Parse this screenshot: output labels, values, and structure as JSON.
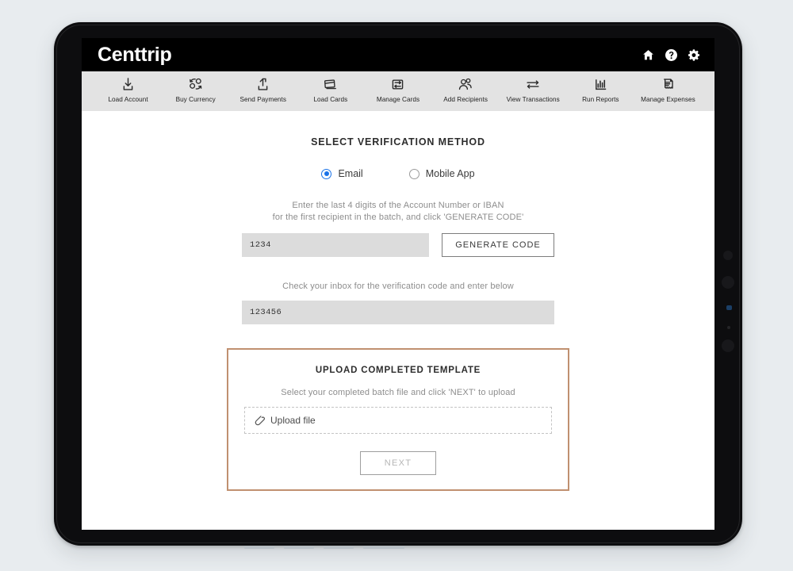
{
  "app": {
    "brand": "Centtrip",
    "header_icons": [
      {
        "name": "home-icon",
        "label": "Home"
      },
      {
        "name": "help-icon",
        "label": "Help"
      },
      {
        "name": "settings-gear-icon",
        "label": "Settings"
      }
    ]
  },
  "toolbar": {
    "items": [
      {
        "label": "Load Account",
        "icon": "download-tray-icon"
      },
      {
        "label": "Buy Currency",
        "icon": "currency-exchange-icon"
      },
      {
        "label": "Send Payments",
        "icon": "upload-tray-icon"
      },
      {
        "label": "Load Cards",
        "icon": "cards-stack-icon"
      },
      {
        "label": "Manage Cards",
        "icon": "card-refresh-icon"
      },
      {
        "label": "Add Recipients",
        "icon": "people-icon"
      },
      {
        "label": "View Transactions",
        "icon": "transfer-arrows-icon"
      },
      {
        "label": "Run Reports",
        "icon": "bar-chart-icon"
      },
      {
        "label": "Manage Expenses",
        "icon": "receipt-icon"
      }
    ]
  },
  "verification": {
    "title": "SELECT VERIFICATION METHOD",
    "options": [
      {
        "label": "Email",
        "selected": true
      },
      {
        "label": "Mobile App",
        "selected": false
      }
    ],
    "digits_help_line1": "Enter the last 4 digits of the Account Number or IBAN",
    "digits_help_line2": "for the first recipient in the batch, and click 'GENERATE CODE'",
    "digits_value": "1234",
    "generate_button": "GENERATE CODE",
    "code_help": "Check your inbox for the verification code and enter below",
    "code_value": "123456"
  },
  "upload": {
    "title": "UPLOAD COMPLETED TEMPLATE",
    "subtitle": "Select your completed batch file and click 'NEXT' to upload",
    "dropzone_label": "Upload file",
    "dropzone_icon": "paperclip-icon",
    "next_button": "NEXT"
  },
  "colors": {
    "header_bg": "#000000",
    "toolbar_bg": "#e3e3e3",
    "page_bg": "#e8ecef",
    "accent_radio": "#1a73e8",
    "panel_border": "#c09070",
    "input_bg": "#dcdcdc"
  }
}
